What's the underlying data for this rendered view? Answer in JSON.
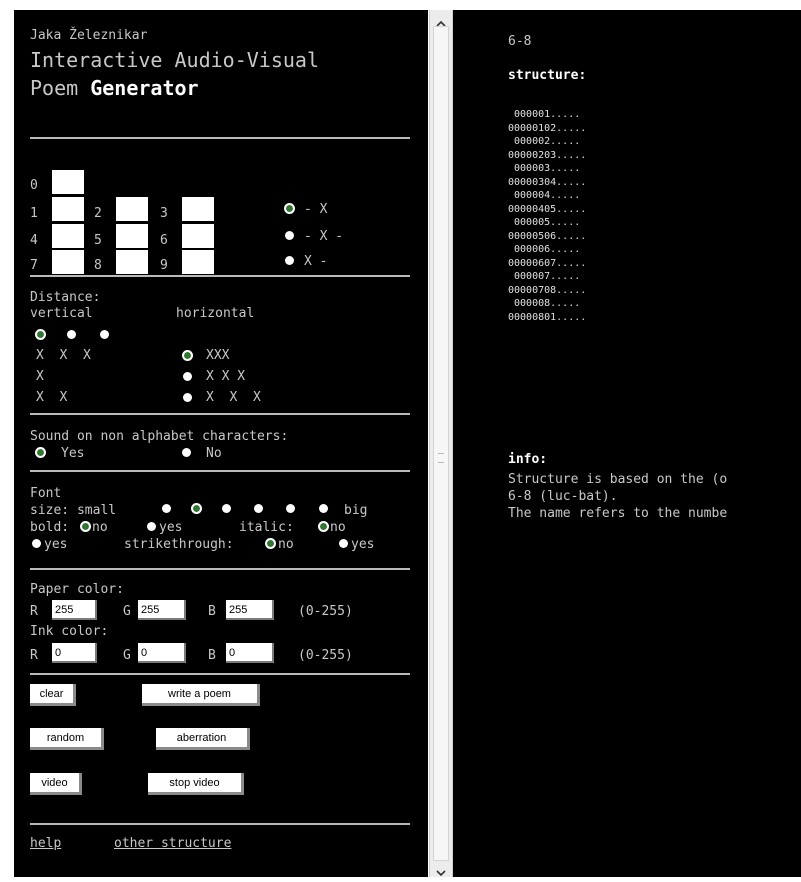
{
  "header": {
    "author": "Jaka Železnikar",
    "title_line1": "Interactive Audio-Visual",
    "title_line2_a": "Poem ",
    "title_line2_b": "Generator"
  },
  "grid": {
    "boxes": [
      "0",
      "1",
      "2",
      "3",
      "4",
      "5",
      "6",
      "7",
      "8",
      "9"
    ],
    "options": [
      "- X",
      "- X -",
      "X -"
    ],
    "selected_option": 0
  },
  "distance": {
    "label": "Distance:",
    "vertical_label": "vertical",
    "horizontal_label": "horizontal",
    "vertical_selected": 0,
    "vertical_patterns": [
      "X  X  X",
      "X",
      "X  X"
    ],
    "horizontal_options": [
      "XXX",
      "X X X",
      "X  X  X"
    ],
    "horizontal_selected": 0
  },
  "sound": {
    "label": "Sound on non alphabet characters:",
    "yes": "Yes",
    "no": "No",
    "selected": "yes"
  },
  "font": {
    "label": "Font",
    "size_label": "size: small",
    "size_end": "big",
    "size_selected": 1,
    "bold_label": "bold:",
    "bold_no": "no",
    "bold_yes": "yes",
    "italic_label": "italic:",
    "italic_no": "no",
    "italic_yes": "yes",
    "strike_label": "strikethrough:",
    "strike_no": "no",
    "strike_yes": "yes"
  },
  "colors": {
    "paper_label": "Paper color:",
    "ink_label": "Ink color:",
    "r": "R",
    "g": "G",
    "b": "B",
    "range": "(0-255)",
    "paper": {
      "r": "255",
      "g": "255",
      "b": "255"
    },
    "ink": {
      "r": "0",
      "g": "0",
      "b": "0"
    }
  },
  "buttons": {
    "clear": "clear",
    "write": "write a poem",
    "random": "random",
    "aberration": "aberration",
    "video": "video",
    "stop_video": "stop video"
  },
  "links": {
    "help": "help",
    "other": "other structure"
  },
  "right": {
    "code": "6-8",
    "structure_label": "structure:",
    "structure_lines": [
      " 000001.....",
      "00000102.....",
      " 000002.....",
      "00000203.....",
      " 000003.....",
      "00000304.....",
      " 000004.....",
      "00000405.....",
      " 000005.....",
      "00000506.....",
      " 000006.....",
      "00000607.....",
      " 000007.....",
      "00000708.....",
      " 000008.....",
      "00000801....."
    ],
    "info_label": "info:",
    "info_lines": [
      "Structure is based on the (o",
      "6-8 (luc-bat).",
      "The name refers to the numbe"
    ]
  },
  "theme": {
    "background": "#000000",
    "text": "#c8c8c8",
    "radio_selected": "#2f7a2f"
  }
}
